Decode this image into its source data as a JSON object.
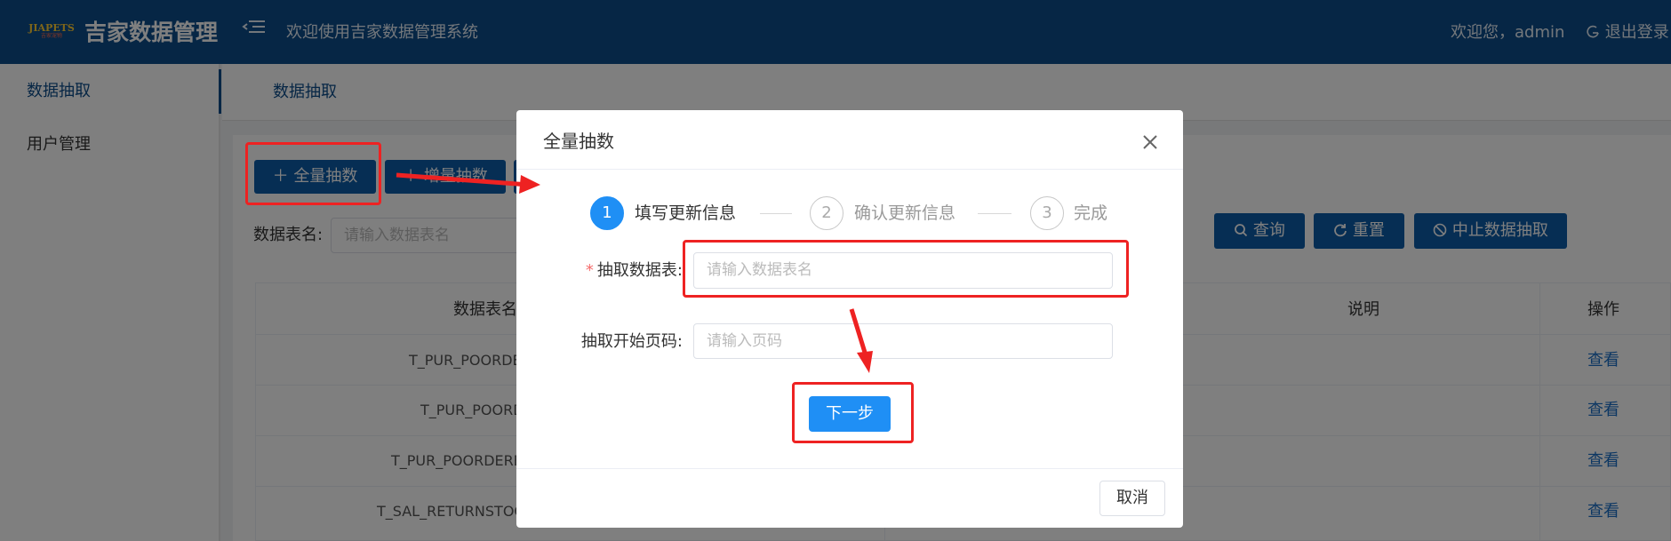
{
  "header": {
    "logo_text": "JIAPETS",
    "logo_subtext": "吉家宠物",
    "title": "吉家数据管理",
    "welcome": "欢迎使用吉家数据管理系统",
    "user_greeting": "欢迎您，admin",
    "logout_label": "退出登录"
  },
  "sidebar": {
    "items": [
      {
        "label": "数据抽取",
        "active": true
      },
      {
        "label": "用户管理",
        "active": false
      }
    ]
  },
  "tabs": [
    {
      "label": "数据抽取"
    }
  ],
  "toolbar": {
    "full_extract_label": "全量抽数",
    "incremental_extract_label": "增量抽数"
  },
  "filter": {
    "table_name_label": "数据表名:",
    "table_name_placeholder": "请输入数据表名"
  },
  "actions": {
    "query_label": "查询",
    "reset_label": "重置",
    "stop_label": "中止数据抽取"
  },
  "table": {
    "columns": [
      "数据表名",
      "说明",
      "操作"
    ],
    "rows": [
      {
        "name": "T_PUR_POORDE",
        "action": "查看"
      },
      {
        "name": "T_PUR_POORD",
        "action": "查看"
      },
      {
        "name": "T_PUR_POORDERE",
        "action": "查看"
      },
      {
        "name": "T_SAL_RETURNSTOC",
        "action": "查看"
      }
    ]
  },
  "dialog": {
    "title": "全量抽数",
    "steps": [
      {
        "index": "1",
        "label": "填写更新信息",
        "active": true
      },
      {
        "index": "2",
        "label": "确认更新信息",
        "active": false
      },
      {
        "index": "3",
        "label": "完成",
        "active": false
      }
    ],
    "fields": {
      "table_label": "抽取数据表:",
      "table_placeholder": "请输入数据表名",
      "page_label": "抽取开始页码:",
      "page_placeholder": "请输入页码"
    },
    "next_label": "下一步",
    "cancel_label": "取消"
  },
  "colors": {
    "header_bg": "#0d4d8b",
    "primary": "#1f8ff5",
    "annotation_red": "#ee2222"
  }
}
